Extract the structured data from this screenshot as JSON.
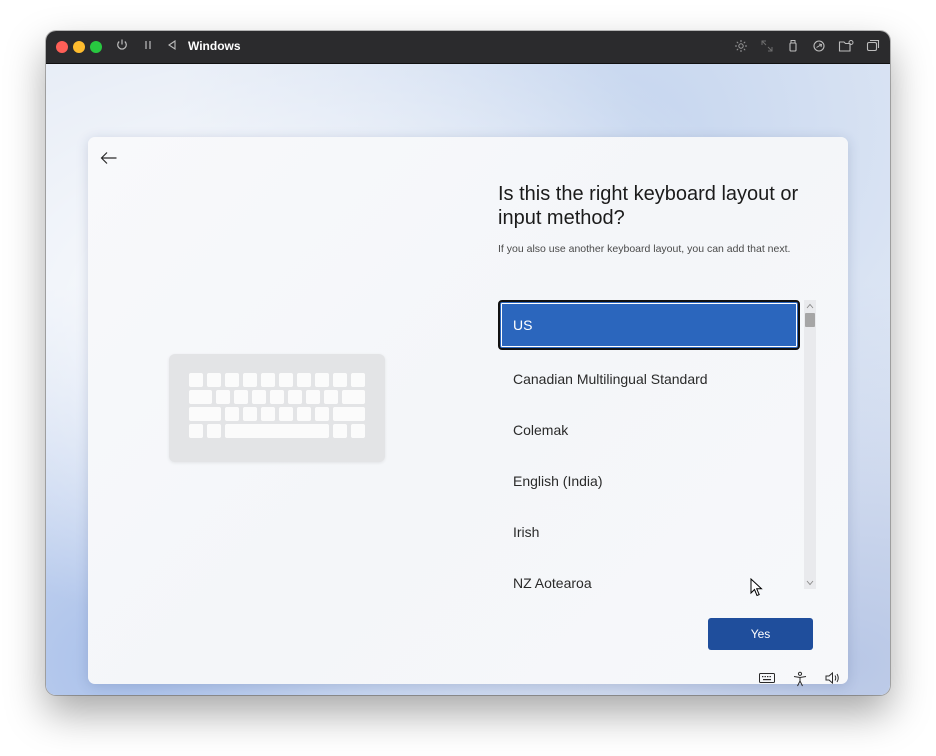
{
  "window": {
    "title": "Windows",
    "controls": [
      "power-icon",
      "pause-icon",
      "back-triangle-icon"
    ],
    "toolbar_icons": [
      "brightness-icon",
      "resize-icon",
      "usb-icon",
      "share-icon",
      "folder-icon",
      "window-icon"
    ]
  },
  "setup": {
    "heading": "Is this the right keyboard layout or input method?",
    "subtext": "If you also use another keyboard layout, you can add that next.",
    "layouts": [
      {
        "label": "US",
        "selected": true
      },
      {
        "label": "Canadian Multilingual Standard",
        "selected": false
      },
      {
        "label": "Colemak",
        "selected": false
      },
      {
        "label": "English (India)",
        "selected": false
      },
      {
        "label": "Irish",
        "selected": false
      },
      {
        "label": "NZ Aotearoa",
        "selected": false
      }
    ],
    "yes_label": "Yes"
  },
  "tray": {
    "icons": [
      "keyboard-icon",
      "accessibility-icon",
      "volume-icon"
    ]
  },
  "colors": {
    "accent": "#1f4e9c",
    "selection": "#2b66bd",
    "titlebar": "#2b2b2d"
  }
}
